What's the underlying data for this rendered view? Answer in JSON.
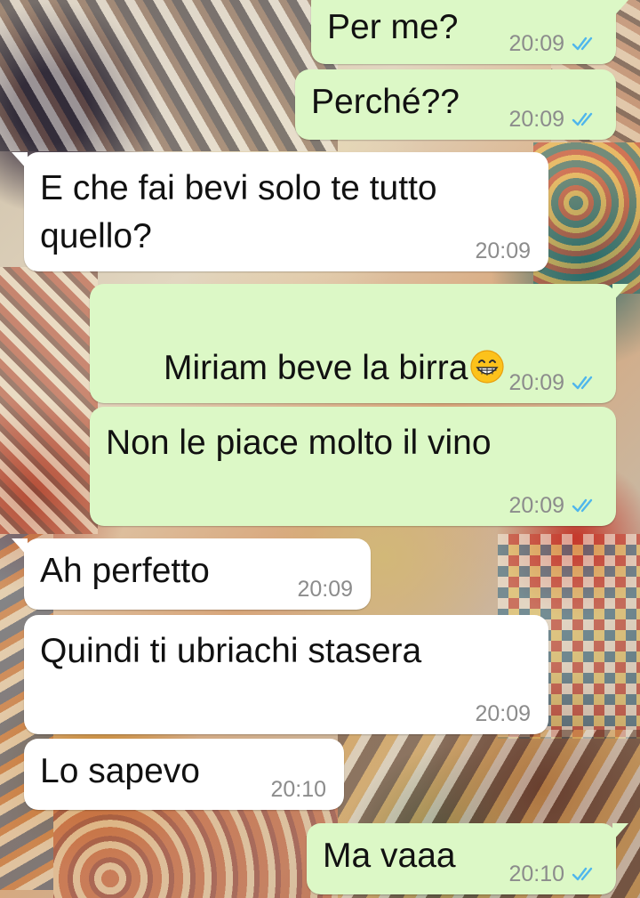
{
  "wallpaper": {
    "description_icon": "patchwork-wallpaper"
  },
  "colors": {
    "outgoing_bubble": "#dcf8c6",
    "incoming_bubble": "#ffffff",
    "timestamp": "#8c8c8c",
    "read_ticks": "#4fb6ec"
  },
  "messages": [
    {
      "direction": "out",
      "text": "Per me?",
      "time": "20:09",
      "status": "read"
    },
    {
      "direction": "out",
      "text": "Perché??",
      "time": "20:09",
      "status": "read"
    },
    {
      "direction": "in",
      "text": "E che fai bevi solo te tutto\nquello?",
      "time": "20:09"
    },
    {
      "direction": "out",
      "text": "Miriam beve la birra",
      "emoji": "grinning-face-with-smiling-eyes-icon",
      "time": "20:09",
      "status": "read"
    },
    {
      "direction": "out",
      "text": "Non le piace molto il vino",
      "time": "20:09",
      "status": "read"
    },
    {
      "direction": "in",
      "text": "Ah perfetto",
      "time": "20:09"
    },
    {
      "direction": "in",
      "text": "Quindi ti ubriachi stasera",
      "time": "20:09"
    },
    {
      "direction": "in",
      "text": "Lo sapevo",
      "time": "20:10"
    },
    {
      "direction": "out",
      "text": "Ma vaaa",
      "time": "20:10",
      "status": "read"
    }
  ]
}
